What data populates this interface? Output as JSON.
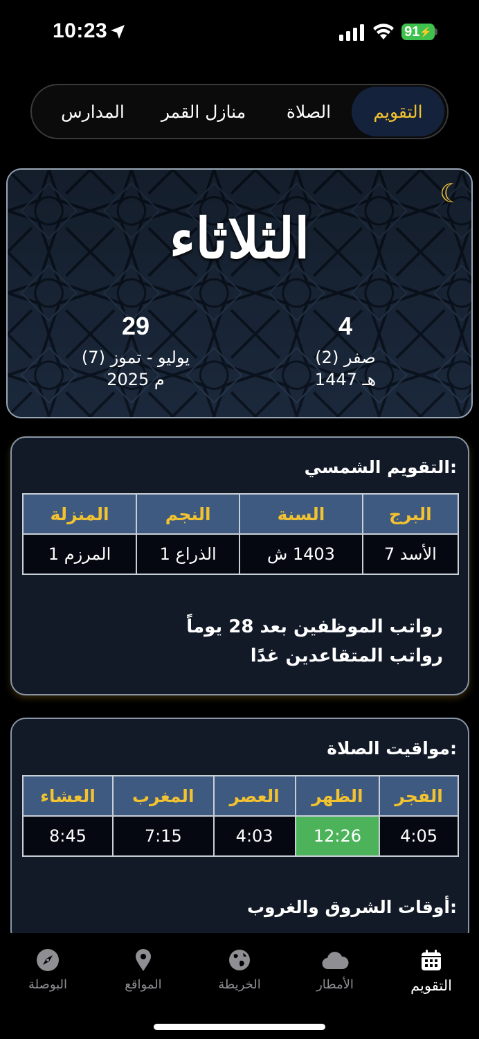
{
  "status": {
    "time": "10:23",
    "battery": "91"
  },
  "tabs": [
    {
      "label": "التقويم",
      "active": true
    },
    {
      "label": "الصلاة",
      "active": false
    },
    {
      "label": "منازل القمر",
      "active": false
    },
    {
      "label": "المدارس",
      "active": false
    }
  ],
  "hero": {
    "day_name": "الثلاثاء",
    "hijri": {
      "day": "4",
      "month": "صفر (2)",
      "year": "1447 هـ"
    },
    "gregorian": {
      "day": "29",
      "month": "يوليو - تموز (7)",
      "year": "2025 م"
    }
  },
  "solar": {
    "title": "التقويم الشمسي:",
    "headers": [
      "البرج",
      "السنة",
      "النجم",
      "المنزلة"
    ],
    "values": [
      "الأسد 7",
      "1403 ش",
      "الذراع 1",
      "المرزم 1"
    ],
    "notes": [
      "رواتب الموظفين بعد 28 يوماً",
      "رواتب المتقاعدين غدًا"
    ]
  },
  "prayer": {
    "title": "مواقيت الصلاة:",
    "headers": [
      "الفجر",
      "الظهر",
      "العصر",
      "المغرب",
      "العشاء"
    ],
    "values": [
      "4:05",
      "12:26",
      "4:03",
      "7:15",
      "8:45"
    ],
    "highlight_index": 1,
    "sunrise_title": "أوقات الشروق والغروب:"
  },
  "nav": [
    {
      "label": "التقويم",
      "icon": "calendar-icon",
      "active": true
    },
    {
      "label": "الأمطار",
      "icon": "cloud-icon",
      "active": false
    },
    {
      "label": "الخريطة",
      "icon": "globe-icon",
      "active": false
    },
    {
      "label": "المواقع",
      "icon": "location-pin-icon",
      "active": false
    },
    {
      "label": "البوصلة",
      "icon": "compass-icon",
      "active": false
    }
  ],
  "colors": {
    "accent": "#f2c230",
    "table_header": "#3e5a80",
    "highlight": "#4db35a",
    "battery": "#3fc24d"
  }
}
